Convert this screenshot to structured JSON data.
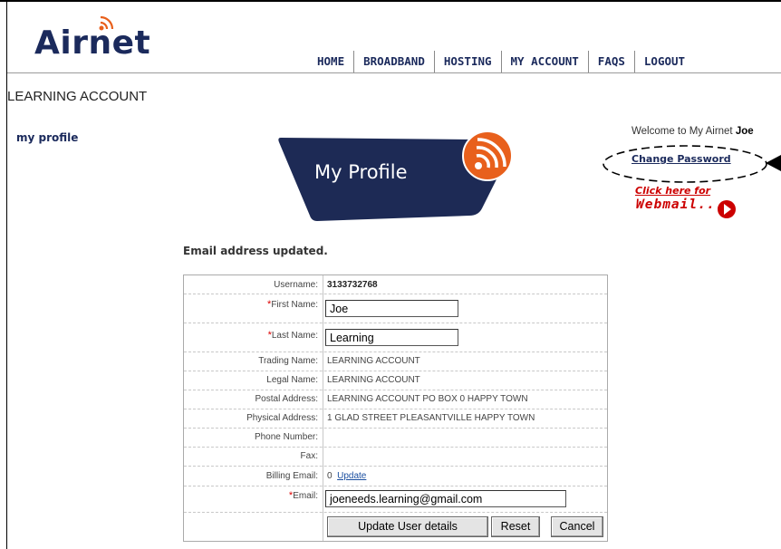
{
  "brand": {
    "logo_text": "Airnet"
  },
  "nav": {
    "items": [
      "HOME",
      "BROADBAND",
      "HOSTING",
      "MY ACCOUNT",
      "FAQS",
      "LOGOUT"
    ]
  },
  "page": {
    "title": "LEARNING ACCOUNT",
    "status_message": "Email address updated."
  },
  "sidebar": {
    "my_profile": "my profile"
  },
  "banner": {
    "title": "My Profile"
  },
  "right": {
    "welcome_prefix": "Welcome to My Airnet",
    "welcome_name": "Joe",
    "change_password": "Change Password",
    "click_here": "Click here for",
    "webmail": "Webmail..."
  },
  "form": {
    "username_label": "Username:",
    "username_value": "3133732768",
    "first_name_label": "First Name:",
    "first_name_value": "Joe",
    "last_name_label": "Last Name:",
    "last_name_value": "Learning",
    "trading_name_label": "Trading Name:",
    "trading_name_value": "LEARNING ACCOUNT",
    "legal_name_label": "Legal Name:",
    "legal_name_value": "LEARNING ACCOUNT",
    "postal_address_label": "Postal Address:",
    "postal_address_value": "LEARNING ACCOUNT PO BOX 0 HAPPY TOWN",
    "physical_address_label": "Physical Address:",
    "physical_address_value": "1 GLAD STREET PLEASANTVILLE HAPPY TOWN",
    "phone_label": "Phone Number:",
    "phone_value": "",
    "fax_label": "Fax:",
    "fax_value": "",
    "billing_email_label": "Billing Email:",
    "billing_email_value": "0",
    "billing_email_update": "Update",
    "email_label": "Email:",
    "email_value": "joeneeds.learning@gmail.com",
    "required_mark": "*",
    "update_button": "Update User details",
    "reset_button": "Reset",
    "cancel_button": "Cancel"
  },
  "colors": {
    "brand_navy": "#1b2a5c",
    "accent_orange": "#e8601c",
    "link_red": "#cc0000"
  },
  "icons": {
    "logo_signal": "signal-waves-icon",
    "banner_signal": "wifi-signal-icon",
    "webmail_go": "play-circle-icon",
    "annotation_arrow": "arrow-left-icon"
  }
}
